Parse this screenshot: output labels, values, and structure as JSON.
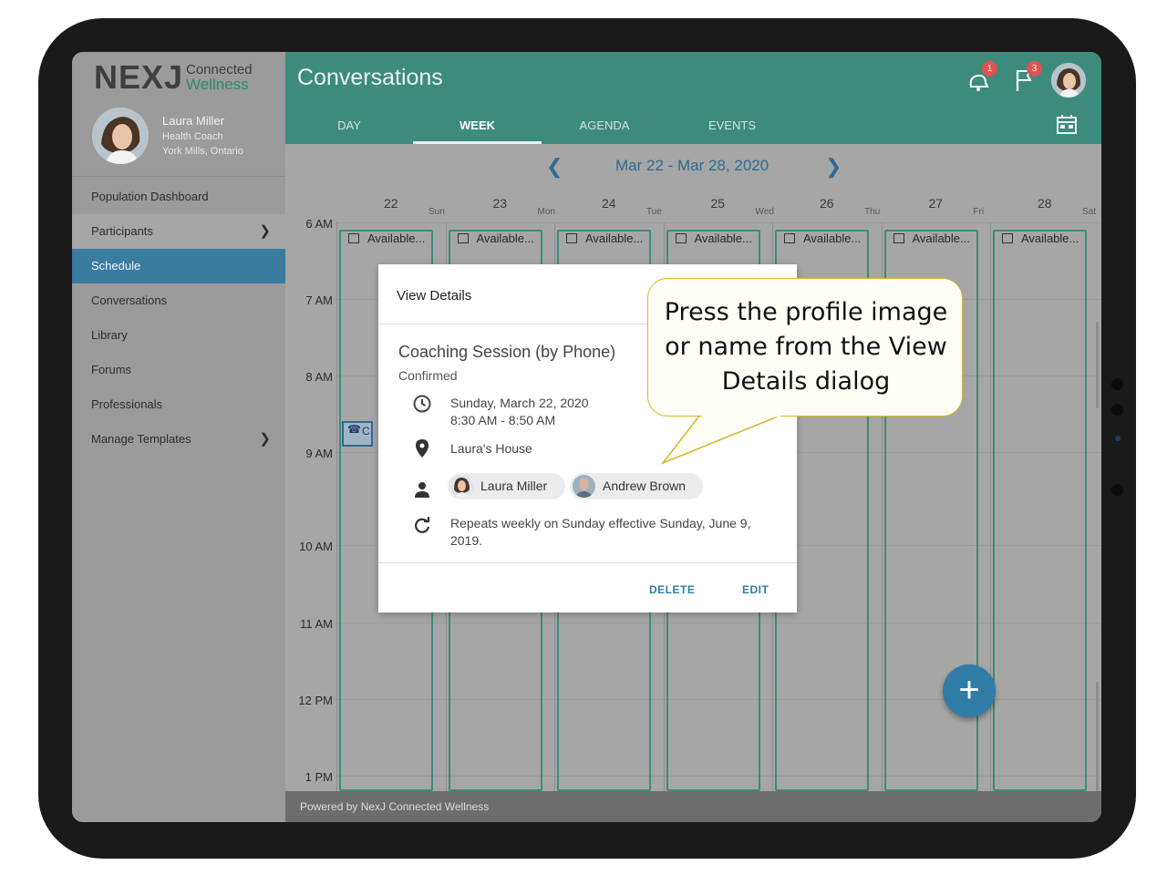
{
  "brand": {
    "logo_main": "NEXJ",
    "logo_line1": "Connected",
    "logo_line2": "Wellness"
  },
  "user": {
    "name": "Laura Miller",
    "role": "Health Coach",
    "location": "York Mills, Ontario"
  },
  "sidebar": {
    "items": [
      {
        "label": "Population Dashboard"
      },
      {
        "label": "Participants"
      },
      {
        "label": "Schedule"
      },
      {
        "label": "Conversations"
      },
      {
        "label": "Library"
      },
      {
        "label": "Forums"
      },
      {
        "label": "Professionals"
      },
      {
        "label": "Manage Templates"
      }
    ]
  },
  "header": {
    "title": "Conversations",
    "notifications_badge": "1",
    "flags_badge": "3",
    "tabs": [
      {
        "label": "DAY"
      },
      {
        "label": "WEEK"
      },
      {
        "label": "AGENDA"
      },
      {
        "label": "EVENTS"
      }
    ]
  },
  "calendar": {
    "date_range": "Mar 22 - Mar 28, 2020",
    "days": [
      {
        "num": "22",
        "abbr": "Sun"
      },
      {
        "num": "23",
        "abbr": "Mon"
      },
      {
        "num": "24",
        "abbr": "Tue"
      },
      {
        "num": "25",
        "abbr": "Wed"
      },
      {
        "num": "26",
        "abbr": "Thu"
      },
      {
        "num": "27",
        "abbr": "Fri"
      },
      {
        "num": "28",
        "abbr": "Sat"
      }
    ],
    "slot_label": "Available...",
    "times": [
      "6 AM",
      "7 AM",
      "8 AM",
      "9 AM",
      "10 AM",
      "11 AM",
      "12 PM",
      "1 PM"
    ],
    "event_chip_letter": "C"
  },
  "footer": {
    "text": "Powered by NexJ Connected Wellness"
  },
  "dialog": {
    "title": "View Details",
    "event_title": "Coaching Session (by Phone)",
    "status": "Confirmed",
    "date": "Sunday, March 22, 2020",
    "time": "8:30 AM - 8:50 AM",
    "location": "Laura's House",
    "participants": [
      {
        "name": "Laura Miller"
      },
      {
        "name": "Andrew Brown"
      }
    ],
    "recurrence": "Repeats weekly on Sunday effective Sunday, June 9, 2019.",
    "delete_label": "DELETE",
    "edit_label": "EDIT"
  },
  "callout": {
    "text": "Press the profile image or name from the View Details dialog"
  },
  "colors": {
    "header": "#3d8c7b",
    "active_nav": "#3a7ba0",
    "accent": "#2f7da6",
    "callout_border": "#d4b62b"
  },
  "icons": [
    "notification-icon",
    "flag-icon",
    "calendar-today-icon",
    "clock-icon",
    "location-pin-icon",
    "person-icon",
    "repeat-icon",
    "add-icon",
    "chevron-left-icon",
    "chevron-right-icon"
  ]
}
